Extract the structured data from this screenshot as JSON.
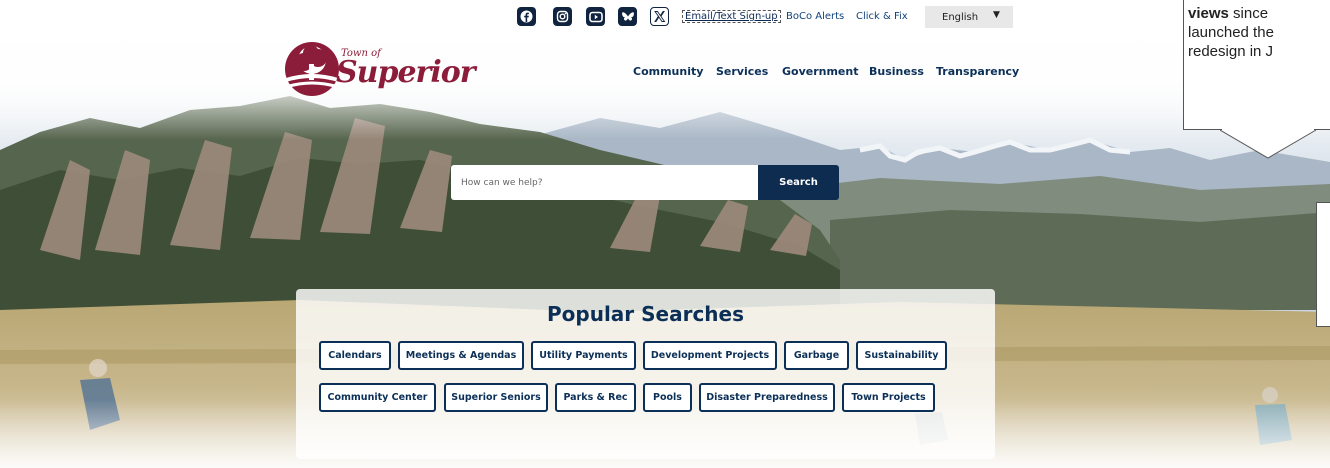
{
  "utility": {
    "socials": [
      {
        "icon": "facebook-icon"
      },
      {
        "icon": "instagram-icon"
      },
      {
        "icon": "youtube-icon"
      },
      {
        "icon": "bluesky-icon"
      },
      {
        "icon": "x-twitter-icon"
      }
    ],
    "signup": "Email/Text Sign-up",
    "alerts": "BoCo Alerts",
    "clickfix": "Click & Fix",
    "language": "English",
    "caret": "▼"
  },
  "logo": {
    "town_of": "Town of",
    "name": "Superior"
  },
  "nav": [
    "Community",
    "Services",
    "Government",
    "Business",
    "Transparency"
  ],
  "callout": {
    "bold": "views",
    "line1_rest": " since",
    "line2": "launched the",
    "line3": "redesign in J"
  },
  "search": {
    "placeholder": "How can we help?",
    "button": "Search"
  },
  "popular": {
    "title": "Popular Searches",
    "row1": [
      "Calendars",
      "Meetings & Agendas",
      "Utility Payments",
      "Development Projects",
      "Garbage",
      "Sustainability"
    ],
    "row2": [
      "Community Center",
      "Superior Seniors",
      "Parks & Rec",
      "Pools",
      "Disaster Preparedness",
      "Town Projects"
    ]
  },
  "colors": {
    "navy": "#0b2f57",
    "brand_maroon": "#8c1d3a",
    "search_button": "#0d2c50"
  }
}
